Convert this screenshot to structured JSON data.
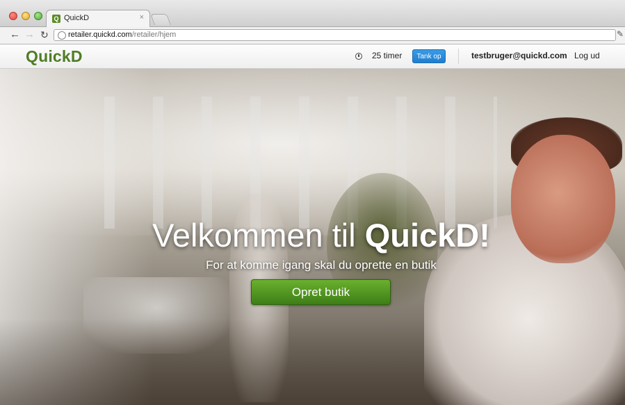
{
  "browser": {
    "tab_title": "QuickD",
    "tab_favicon": "Q",
    "tab_close": "×",
    "url_host": "retailer.quickd.com",
    "url_path": "/retailer/hjem",
    "icons": {
      "back": "arrow-left-icon",
      "forward": "arrow-right-icon",
      "reload": "reload-icon",
      "menu": "wrench-icon"
    }
  },
  "header": {
    "logo": "QuickD",
    "timer": "25 timer",
    "topup_label": "Tank op",
    "user_email": "testbruger@quickd.com",
    "logout_label": "Log ud",
    "accent_color": "#1f7fd0",
    "brand_color": "#4f7d24"
  },
  "hero": {
    "title_prefix": "Velkommen til ",
    "title_brand": "QuickD!",
    "subtitle": "For at komme igang skal du oprette en butik",
    "cta_label": "Opret butik",
    "cta_color": "#4e931f"
  }
}
